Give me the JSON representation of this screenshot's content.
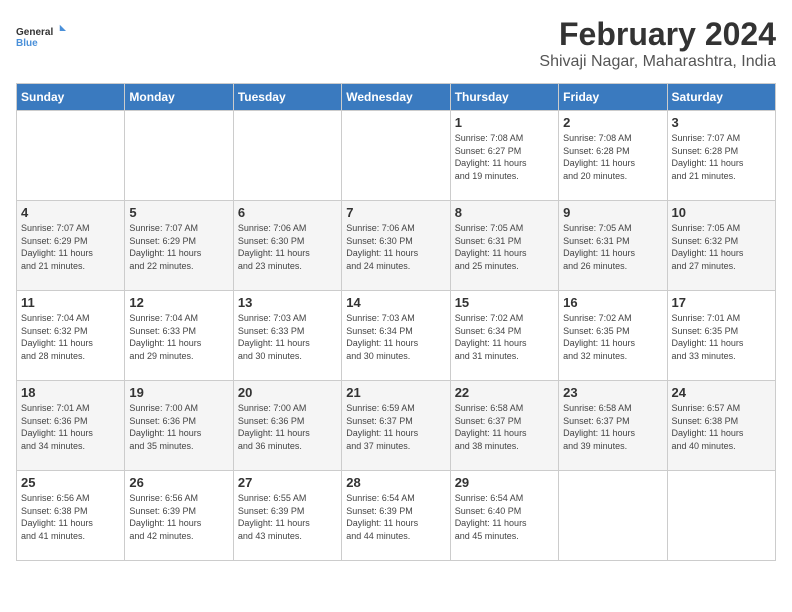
{
  "logo": {
    "line1": "General",
    "line2": "Blue"
  },
  "title": "February 2024",
  "subtitle": "Shivaji Nagar, Maharashtra, India",
  "weekdays": [
    "Sunday",
    "Monday",
    "Tuesday",
    "Wednesday",
    "Thursday",
    "Friday",
    "Saturday"
  ],
  "weeks": [
    [
      {
        "day": "",
        "info": ""
      },
      {
        "day": "",
        "info": ""
      },
      {
        "day": "",
        "info": ""
      },
      {
        "day": "",
        "info": ""
      },
      {
        "day": "1",
        "info": "Sunrise: 7:08 AM\nSunset: 6:27 PM\nDaylight: 11 hours\nand 19 minutes."
      },
      {
        "day": "2",
        "info": "Sunrise: 7:08 AM\nSunset: 6:28 PM\nDaylight: 11 hours\nand 20 minutes."
      },
      {
        "day": "3",
        "info": "Sunrise: 7:07 AM\nSunset: 6:28 PM\nDaylight: 11 hours\nand 21 minutes."
      }
    ],
    [
      {
        "day": "4",
        "info": "Sunrise: 7:07 AM\nSunset: 6:29 PM\nDaylight: 11 hours\nand 21 minutes."
      },
      {
        "day": "5",
        "info": "Sunrise: 7:07 AM\nSunset: 6:29 PM\nDaylight: 11 hours\nand 22 minutes."
      },
      {
        "day": "6",
        "info": "Sunrise: 7:06 AM\nSunset: 6:30 PM\nDaylight: 11 hours\nand 23 minutes."
      },
      {
        "day": "7",
        "info": "Sunrise: 7:06 AM\nSunset: 6:30 PM\nDaylight: 11 hours\nand 24 minutes."
      },
      {
        "day": "8",
        "info": "Sunrise: 7:05 AM\nSunset: 6:31 PM\nDaylight: 11 hours\nand 25 minutes."
      },
      {
        "day": "9",
        "info": "Sunrise: 7:05 AM\nSunset: 6:31 PM\nDaylight: 11 hours\nand 26 minutes."
      },
      {
        "day": "10",
        "info": "Sunrise: 7:05 AM\nSunset: 6:32 PM\nDaylight: 11 hours\nand 27 minutes."
      }
    ],
    [
      {
        "day": "11",
        "info": "Sunrise: 7:04 AM\nSunset: 6:32 PM\nDaylight: 11 hours\nand 28 minutes."
      },
      {
        "day": "12",
        "info": "Sunrise: 7:04 AM\nSunset: 6:33 PM\nDaylight: 11 hours\nand 29 minutes."
      },
      {
        "day": "13",
        "info": "Sunrise: 7:03 AM\nSunset: 6:33 PM\nDaylight: 11 hours\nand 30 minutes."
      },
      {
        "day": "14",
        "info": "Sunrise: 7:03 AM\nSunset: 6:34 PM\nDaylight: 11 hours\nand 30 minutes."
      },
      {
        "day": "15",
        "info": "Sunrise: 7:02 AM\nSunset: 6:34 PM\nDaylight: 11 hours\nand 31 minutes."
      },
      {
        "day": "16",
        "info": "Sunrise: 7:02 AM\nSunset: 6:35 PM\nDaylight: 11 hours\nand 32 minutes."
      },
      {
        "day": "17",
        "info": "Sunrise: 7:01 AM\nSunset: 6:35 PM\nDaylight: 11 hours\nand 33 minutes."
      }
    ],
    [
      {
        "day": "18",
        "info": "Sunrise: 7:01 AM\nSunset: 6:36 PM\nDaylight: 11 hours\nand 34 minutes."
      },
      {
        "day": "19",
        "info": "Sunrise: 7:00 AM\nSunset: 6:36 PM\nDaylight: 11 hours\nand 35 minutes."
      },
      {
        "day": "20",
        "info": "Sunrise: 7:00 AM\nSunset: 6:36 PM\nDaylight: 11 hours\nand 36 minutes."
      },
      {
        "day": "21",
        "info": "Sunrise: 6:59 AM\nSunset: 6:37 PM\nDaylight: 11 hours\nand 37 minutes."
      },
      {
        "day": "22",
        "info": "Sunrise: 6:58 AM\nSunset: 6:37 PM\nDaylight: 11 hours\nand 38 minutes."
      },
      {
        "day": "23",
        "info": "Sunrise: 6:58 AM\nSunset: 6:37 PM\nDaylight: 11 hours\nand 39 minutes."
      },
      {
        "day": "24",
        "info": "Sunrise: 6:57 AM\nSunset: 6:38 PM\nDaylight: 11 hours\nand 40 minutes."
      }
    ],
    [
      {
        "day": "25",
        "info": "Sunrise: 6:56 AM\nSunset: 6:38 PM\nDaylight: 11 hours\nand 41 minutes."
      },
      {
        "day": "26",
        "info": "Sunrise: 6:56 AM\nSunset: 6:39 PM\nDaylight: 11 hours\nand 42 minutes."
      },
      {
        "day": "27",
        "info": "Sunrise: 6:55 AM\nSunset: 6:39 PM\nDaylight: 11 hours\nand 43 minutes."
      },
      {
        "day": "28",
        "info": "Sunrise: 6:54 AM\nSunset: 6:39 PM\nDaylight: 11 hours\nand 44 minutes."
      },
      {
        "day": "29",
        "info": "Sunrise: 6:54 AM\nSunset: 6:40 PM\nDaylight: 11 hours\nand 45 minutes."
      },
      {
        "day": "",
        "info": ""
      },
      {
        "day": "",
        "info": ""
      }
    ]
  ]
}
